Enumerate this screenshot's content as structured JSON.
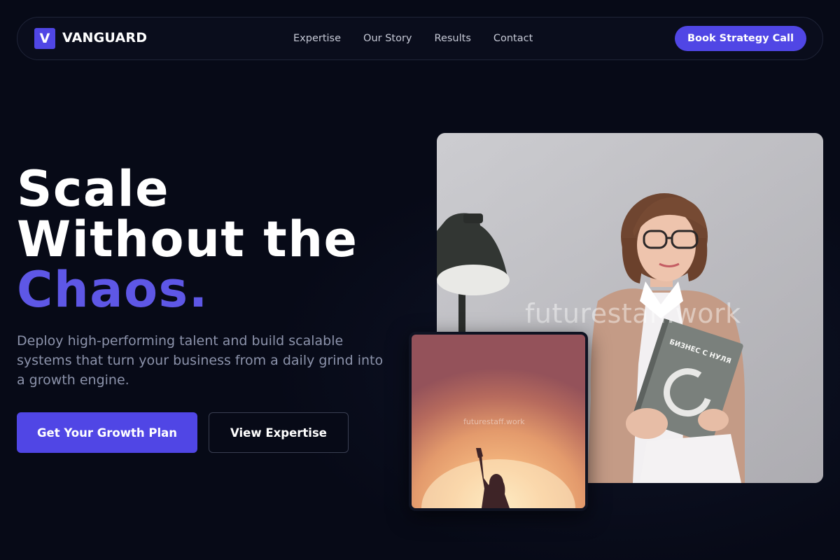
{
  "brand": {
    "logo_letter": "V",
    "name": "VANGUARD",
    "accent_color": "#5046e5"
  },
  "nav": {
    "links": [
      "Expertise",
      "Our Story",
      "Results",
      "Contact"
    ],
    "cta_label": "Book Strategy Call"
  },
  "hero": {
    "headline_line1": "Scale",
    "headline_line2": "Without the",
    "headline_accent": "Chaos.",
    "subtext": "Deploy high-performing talent and build scalable systems that turn your business from a daily grind into a growth engine.",
    "primary_button": "Get Your Growth Plan",
    "secondary_button": "View Expertise"
  },
  "images": {
    "main_photo_watermark": "futurestaff.work",
    "main_photo_book_title": "БИЗНЕС С НУЛЯ",
    "small_photo_watermark": "futurestaff.work"
  },
  "icons": {
    "logo": "letter-v-logo-icon"
  }
}
